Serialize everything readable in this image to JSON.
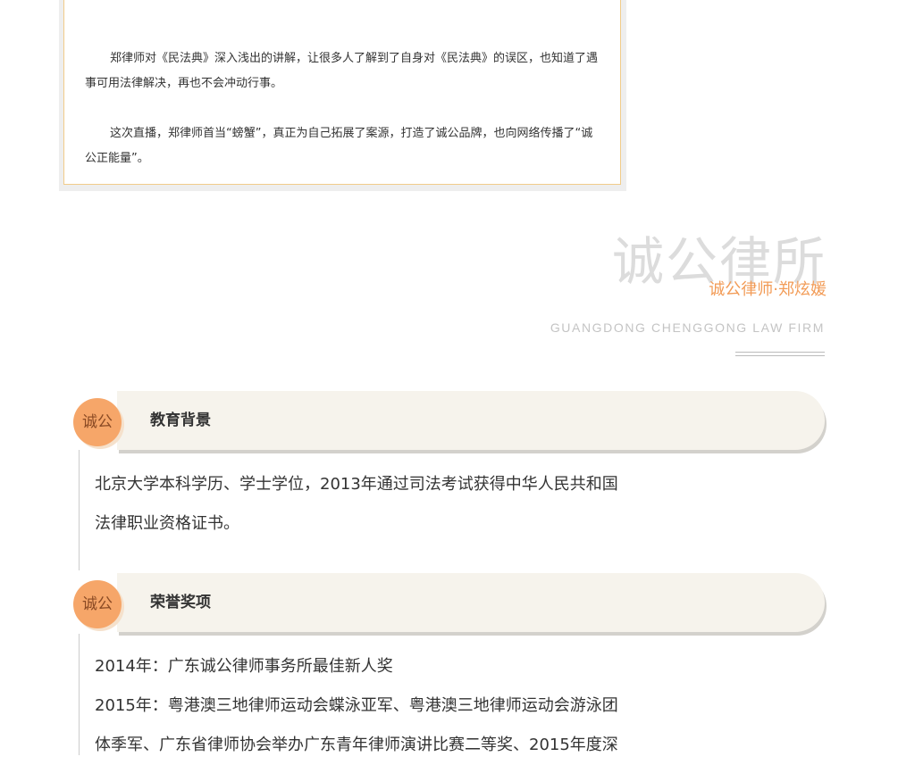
{
  "quote_card": {
    "paragraph_1": "郑律师对《民法典》深入浅出的讲解，让很多人了解到了自身对《民法典》的误区，也知道了遇事可用法律解决，再也不会冲动行事。",
    "paragraph_2": "这次直播，郑律师首当“螃蟹”，真正为自己拓展了案源，打造了诚公品牌，也向网络传播了“诚公正能量”。"
  },
  "heading": {
    "firm_name": "诚公律所",
    "lawyer_line": "诚公律师·郑炫媛",
    "english_name": "GUANGDONG CHENGGONG LAW FIRM"
  },
  "sections": [
    {
      "badge": "诚公",
      "title": "教育背景",
      "lines": [
        "北京大学本科学历、学士学位，2013年通过司法考试获得中华人民共和国",
        "法律职业资格证书。"
      ]
    },
    {
      "badge": "诚公",
      "title": "荣誉奖项",
      "lines": [
        "2014年：广东诚公律师事务所最佳新人奖",
        "2015年：粤港澳三地律师运动会蝶泳亚军、粤港澳三地律师运动会游泳团",
        "体季军、广东省律师协会举办广东青年律师演讲比赛二等奖、2015年度深"
      ]
    }
  ],
  "colors": {
    "accent_orange": "#f29b56",
    "badge_orange": "#f6a669",
    "card_border": "#f1cc8a",
    "bar_bg": "#f6f3ec"
  }
}
